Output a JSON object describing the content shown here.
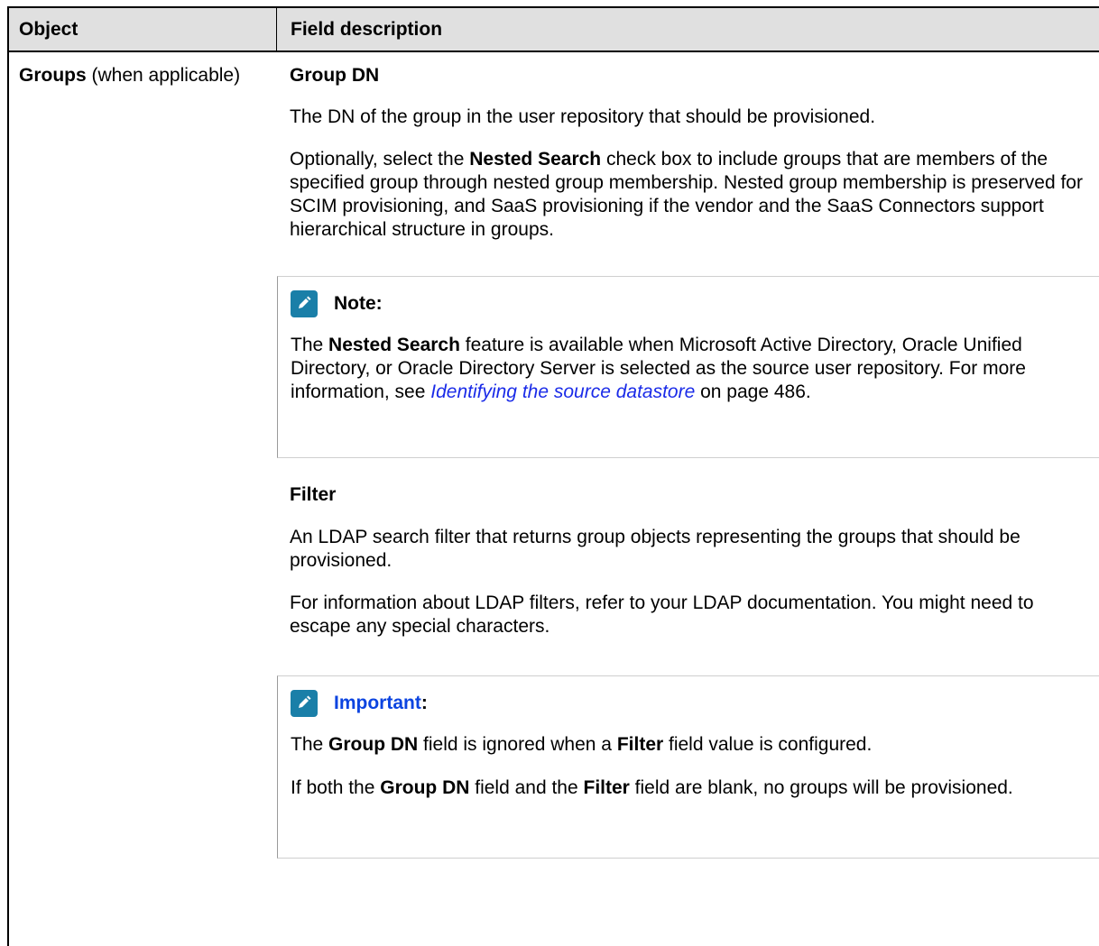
{
  "table": {
    "header": {
      "object": "Object",
      "field_description": "Field description"
    },
    "row": {
      "object_bold": "Groups",
      "object_rest": " (when applicable)",
      "group_dn": {
        "heading": "Group DN",
        "p1": "The DN of the group in the user repository that should be provisioned.",
        "p2_pre": "Optionally, select the ",
        "p2_bold": "Nested Search",
        "p2_post": " check box to include groups that are members of the specified group through nested group membership. Nested group membership is preserved for SCIM provisioning, and SaaS provisioning if the vendor and the SaaS Connectors support hierarchical structure in groups.",
        "note": {
          "icon": "pencil-icon",
          "title": "Note:",
          "pre": "The ",
          "bold": "Nested Search",
          "mid": " feature is available when Microsoft Active Directory, Oracle Unified Directory, or Oracle Directory Server is selected as the source user repository. For more information, see ",
          "link": "Identifying the source datastore",
          "post": " on page 486."
        }
      },
      "filter": {
        "heading": "Filter",
        "p1": "An LDAP search filter that returns group objects representing the groups that should be provisioned.",
        "p2": "For information about LDAP filters, refer to your LDAP documentation. You might need to escape any special characters.",
        "important": {
          "icon": "pencil-icon",
          "title": "Important",
          "colon": ":",
          "l1_pre": "The ",
          "l1_b1": "Group DN",
          "l1_mid": " field is ignored when a ",
          "l1_b2": "Filter",
          "l1_post": " field value is configured.",
          "l2_pre": "If both the ",
          "l2_b1": "Group DN",
          "l2_mid": " field and the ",
          "l2_b2": "Filter",
          "l2_post": " field are blank, no groups will be provisioned."
        }
      }
    }
  },
  "colors": {
    "header_bg": "#e0e0e0",
    "icon_bg": "#1a7fa8",
    "important": "#0c44e0",
    "link": "#1a2be8"
  }
}
